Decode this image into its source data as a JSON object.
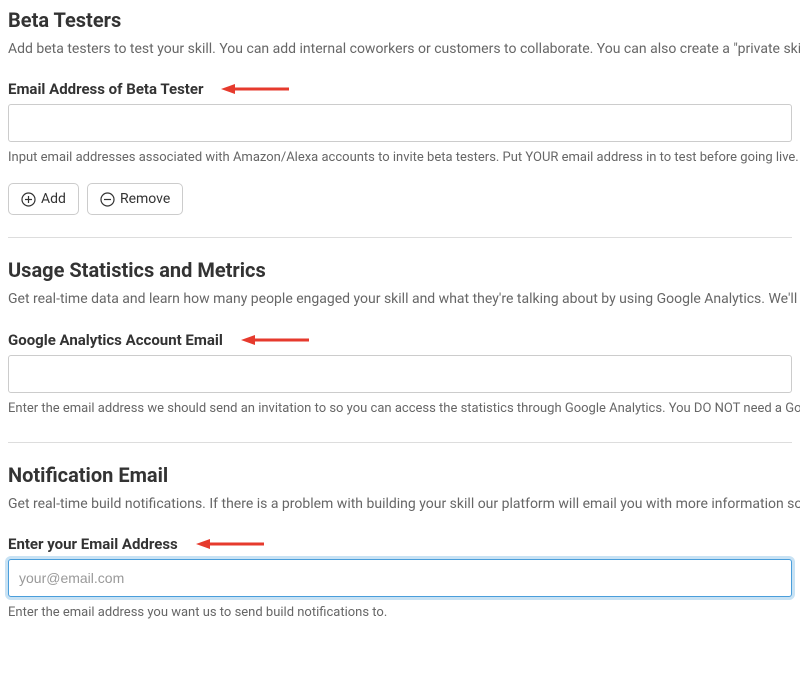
{
  "sections": {
    "beta_testers": {
      "title": "Beta Testers",
      "desc": "Add beta testers to test your skill. You can add internal coworkers or customers to collaborate. You can also create a \"private skill\" with beta testers.",
      "field_label": "Email Address of Beta Tester",
      "input_value": "",
      "help": "Input email addresses associated with Amazon/Alexa accounts to invite beta testers. Put YOUR email address in to test before going live.",
      "add_label": "Add",
      "remove_label": "Remove"
    },
    "usage_stats": {
      "title": "Usage Statistics and Metrics",
      "desc": "Get real-time data and learn how many people engaged your skill and what they're talking about by using Google Analytics. We'll store your data there and give you self-service access to it any time.",
      "field_label": "Google Analytics Account Email",
      "input_value": "",
      "help": "Enter the email address we should send an invitation to so you can access the statistics through Google Analytics. You DO NOT need a Google Analytics account for this."
    },
    "notification": {
      "title": "Notification Email",
      "desc": "Get real-time build notifications. If there is a problem with building your skill our platform will email you with more information so you can fix issues.",
      "field_label": "Enter your Email Address",
      "input_value": "",
      "input_placeholder": "your@email.com",
      "help": "Enter the email address you want us to send build notifications to."
    }
  },
  "colors": {
    "arrow": "#e63a2d"
  }
}
